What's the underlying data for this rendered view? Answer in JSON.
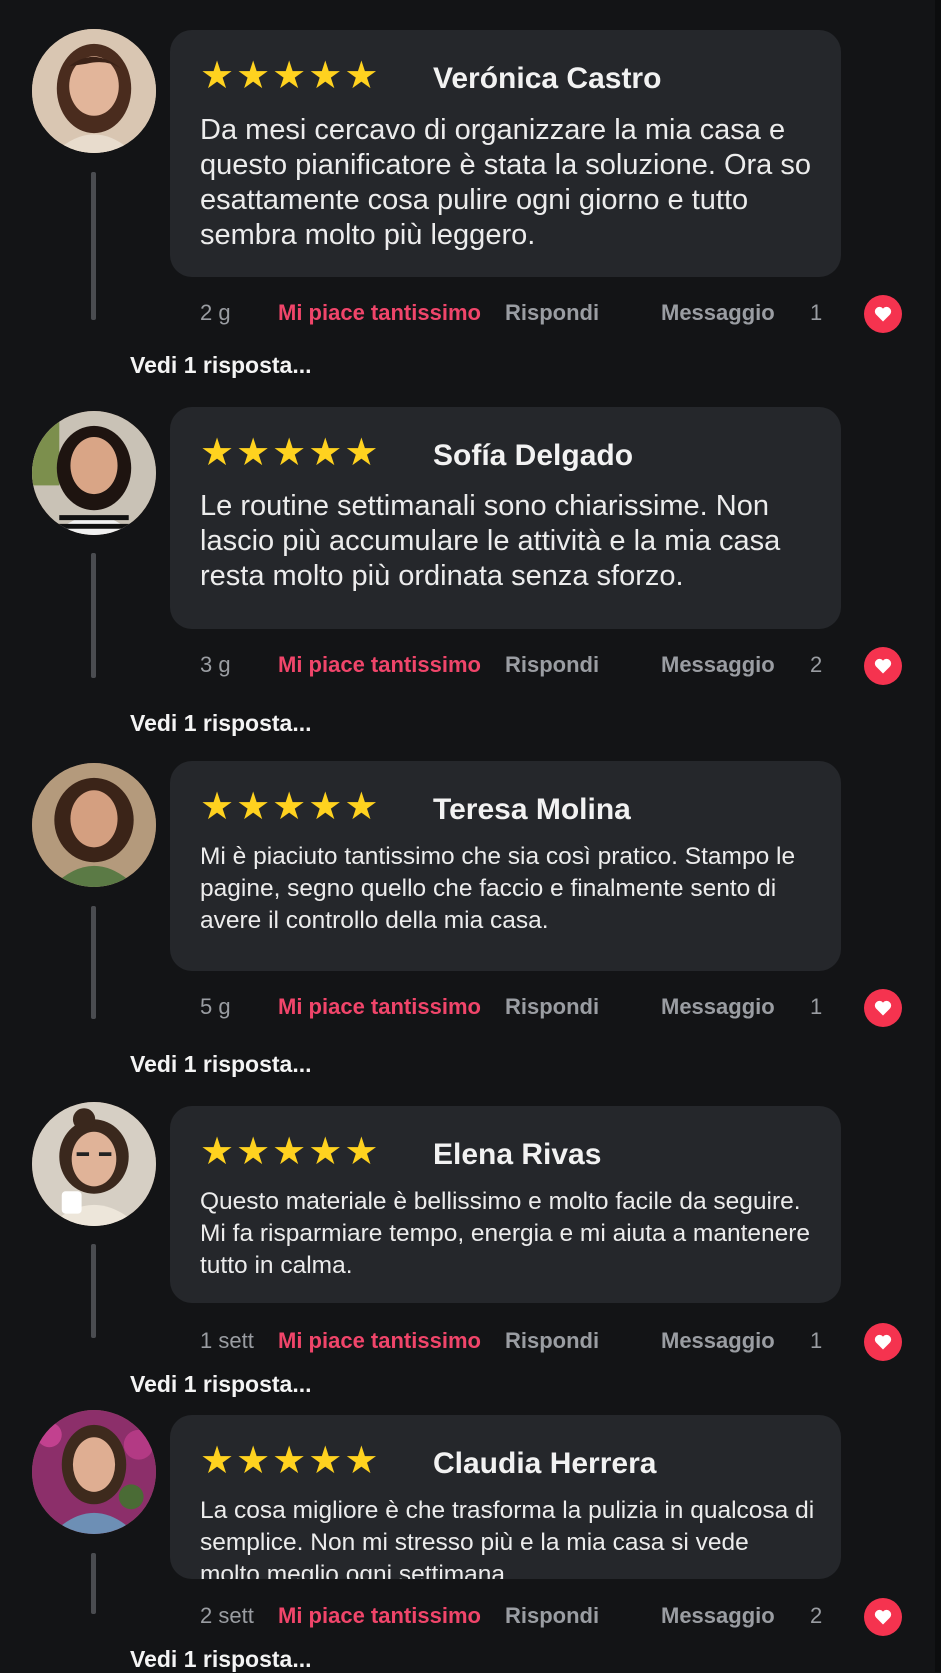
{
  "colors": {
    "background": "#131416",
    "bubble": "#25272b",
    "star": "#ffd21f",
    "like": "#f0456a",
    "heart_button": "#f5334f"
  },
  "icons": {
    "star": "star-icon",
    "heart": "heart-icon"
  },
  "comments": [
    {
      "name": "Verónica Castro",
      "rating": 5,
      "stars": "★★★★★",
      "text": "Da mesi cercavo di organizzare la mia casa e questo pianificatore è stata la soluzione. Ora so esattamente cosa pulire ogni giorno e tutto sembra molto più leggero.",
      "time": "2 g",
      "like_label": "Mi piace tantissimo",
      "reply_label": "Rispondi",
      "message_label": "Messaggio",
      "count": "1",
      "replies_label": "Vedi 1 risposta..."
    },
    {
      "name": "Sofía Delgado",
      "rating": 5,
      "stars": "★★★★★",
      "text": "Le routine settimanali sono chiarissime. Non lascio più accumulare le attività e la mia casa resta molto più ordinata senza sforzo.",
      "time": "3 g",
      "like_label": "Mi piace tantissimo",
      "reply_label": "Rispondi",
      "message_label": "Messaggio",
      "count": "2",
      "replies_label": "Vedi 1 risposta..."
    },
    {
      "name": "Teresa Molina",
      "rating": 5,
      "stars": "★★★★★",
      "text": "Mi è piaciuto tantissimo che sia così pratico. Stampo le pagine, segno quello che faccio e finalmente sento di avere il controllo della mia casa.",
      "time": "5 g",
      "like_label": "Mi piace tantissimo",
      "reply_label": "Rispondi",
      "message_label": "Messaggio",
      "count": "1",
      "replies_label": "Vedi 1 risposta..."
    },
    {
      "name": "Elena Rivas",
      "rating": 5,
      "stars": "★★★★★",
      "text": "Questo materiale è bellissimo e molto facile da seguire. Mi fa risparmiare tempo, energia e mi aiuta a mantenere tutto in calma.",
      "time": "1 sett",
      "like_label": "Mi piace tantissimo",
      "reply_label": "Rispondi",
      "message_label": "Messaggio",
      "count": "1",
      "replies_label": "Vedi 1 risposta..."
    },
    {
      "name": "Claudia Herrera",
      "rating": 5,
      "stars": "★★★★★",
      "text": "La cosa migliore è che trasforma la pulizia in qualcosa di semplice. Non mi stresso più e la mia casa si vede molto meglio ogni settimana.",
      "time": "2 sett",
      "like_label": "Mi piace tantissimo",
      "reply_label": "Rispondi",
      "message_label": "Messaggio",
      "count": "2",
      "replies_label": "Vedi 1 risposta..."
    }
  ]
}
